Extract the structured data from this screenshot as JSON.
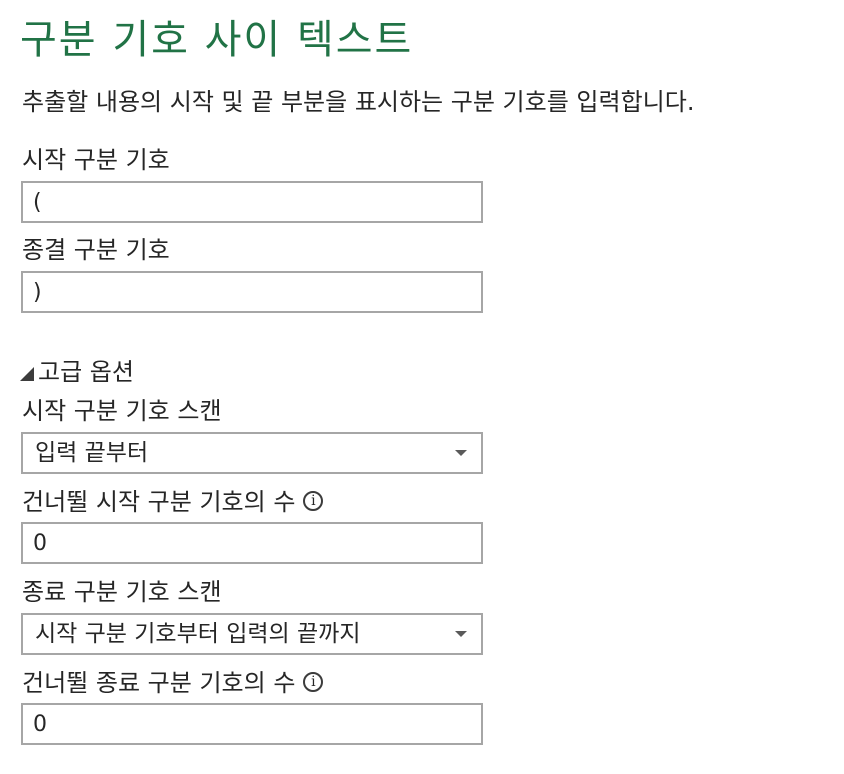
{
  "dialog": {
    "title": "구분 기호 사이 텍스트",
    "description": "추출할 내용의 시작 및 끝 부분을 표시하는 구분 기호를 입력합니다."
  },
  "fields": {
    "start_delimiter": {
      "label": "시작 구분 기호",
      "value": "("
    },
    "end_delimiter": {
      "label": "종결 구분 기호",
      "value": ")"
    }
  },
  "advanced": {
    "toggle_label": "고급 옵션",
    "toggle_icon": "collapse-triangle-icon",
    "scan_start": {
      "label": "시작 구분 기호 스캔",
      "selected": "입력 끝부터"
    },
    "skip_start": {
      "label": "건너뛸 시작 구분 기호의 수",
      "info_glyph": "i",
      "value": "0"
    },
    "scan_end": {
      "label": "종료 구분 기호 스캔",
      "selected": "시작 구분 기호부터 입력의 끝까지"
    },
    "skip_end": {
      "label": "건너뛸 종료 구분 기호의 수",
      "info_glyph": "i",
      "value": "0"
    }
  },
  "colors": {
    "title": "#217346",
    "text": "#262626",
    "border": "#a6a6a6"
  }
}
